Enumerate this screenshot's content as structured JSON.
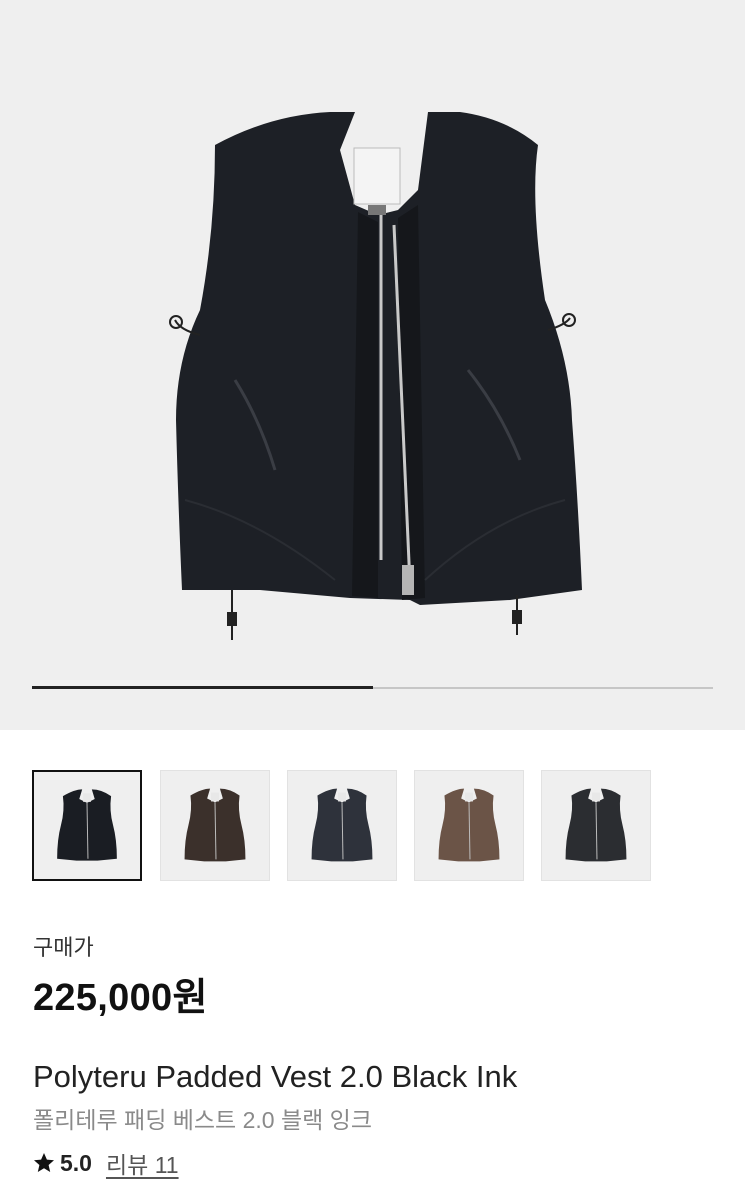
{
  "gallery": {
    "main_image": {
      "icon": "padded-vest-black-image",
      "color": "#1d2026"
    },
    "progress": 0.5,
    "thumbnails": [
      {
        "icon": "vest-black-thumbnail",
        "color": "#1a1d23",
        "selected": true
      },
      {
        "icon": "vest-brown-thumbnail",
        "color": "#3b302b",
        "selected": false
      },
      {
        "icon": "vest-charcoal-thumbnail",
        "color": "#2e323b",
        "selected": false
      },
      {
        "icon": "vest-mocha-thumbnail",
        "color": "#6b5447",
        "selected": false
      },
      {
        "icon": "vest-grey-thumbnail",
        "color": "#2b2d31",
        "selected": false
      }
    ]
  },
  "product": {
    "price_label": "구매가",
    "price": "225,000원",
    "name_en": "Polyteru Padded Vest 2.0 Black Ink",
    "name_ko": "폴리테루 패딩 베스트 2.0 블랙 잉크",
    "rating": {
      "icon": "star-icon",
      "value": "5.0",
      "reviews": "리뷰 11"
    }
  }
}
